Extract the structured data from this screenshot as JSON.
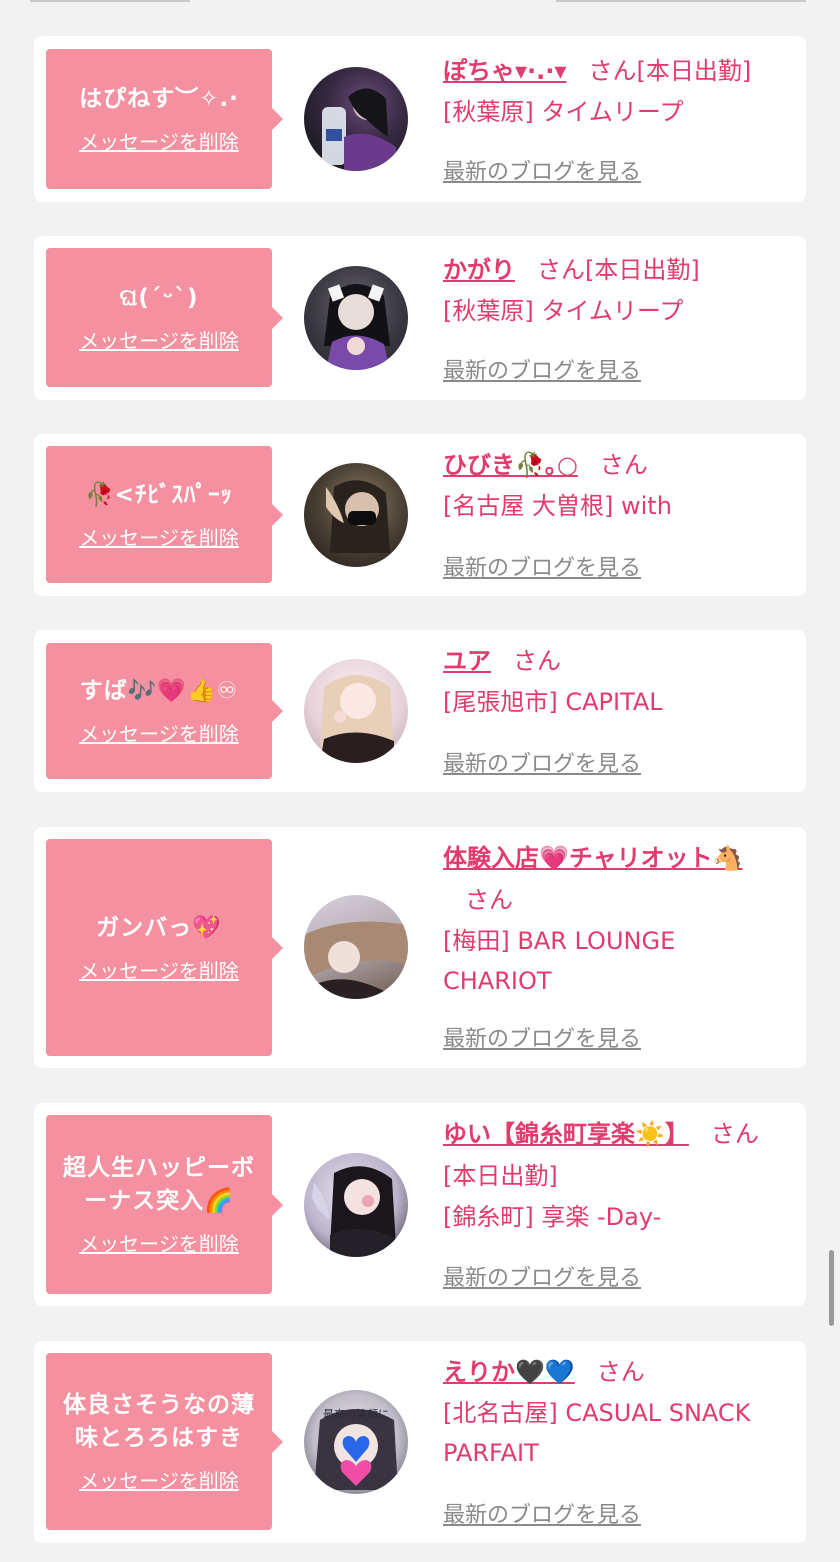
{
  "cards": [
    {
      "message": "はぴねす︶✧.·",
      "delete_label": "メッセージを削除",
      "name": "ぽちゃ▾·.·▾",
      "suffix": "さん[本日出勤]",
      "shop": "[秋葉原] タイムリープ",
      "blog_label": "最新のブログを見る",
      "avatar_colors": [
        "#1c1c26",
        "#6a4c7c"
      ]
    },
    {
      "message": "ଘ(ˊᵕˋ)",
      "delete_label": "メッセージを削除",
      "name": "かがり",
      "suffix": "さん[本日出勤]",
      "shop": "[秋葉原] タイムリープ",
      "blog_label": "最新のブログを見る",
      "avatar_colors": [
        "#4a4a52",
        "#8c6aa8"
      ]
    },
    {
      "message": "🥀<ﾁﾋﾞｽﾊﾟｰｯ",
      "delete_label": "メッセージを削除",
      "name": "ひびき🥀｡○",
      "suffix": "さん",
      "shop": "[名古屋 大曽根] with",
      "blog_label": "最新のブログを見る",
      "avatar_colors": [
        "#2a2620",
        "#8a7a62"
      ]
    },
    {
      "message": "すば🎶💗👍♾",
      "delete_label": "メッセージを削除",
      "name": "ユア",
      "suffix": "さん",
      "shop": "[尾張旭市] CAPITAL",
      "blog_label": "最新のブログを見る",
      "avatar_colors": [
        "#f0e0e4",
        "#3a2a2a"
      ]
    },
    {
      "message": "ガンバっ💖",
      "delete_label": "メッセージを削除",
      "name": "体験入店💗チャリオット🐴",
      "suffix": "さん",
      "shop": "[梅田] BAR LOUNGE CHARIOT",
      "blog_label": "最新のブログを見る",
      "avatar_colors": [
        "#c8bcc4",
        "#6e5a4e"
      ]
    },
    {
      "message": "超人生ハッピーボーナス突入🌈",
      "delete_label": "メッセージを削除",
      "name": "ゆい【錦糸町享楽☀️】",
      "suffix": "さん[本日出勤]",
      "shop": "[錦糸町] 享楽 -Day-",
      "blog_label": "最新のブログを見る",
      "avatar_colors": [
        "#d8d4e4",
        "#2a2228"
      ]
    },
    {
      "message": "体良さそうなの薄味とろろはすき",
      "delete_label": "メッセージを削除",
      "name": "えりか🖤💙",
      "suffix": "さん",
      "shop": "[北名古屋] CASUAL SNACK PARFAIT",
      "blog_label": "最新のブログを見る",
      "avatar_colors": [
        "#d8d8e0",
        "#4a4a58"
      ],
      "avatar_text": "最高の笑顔に"
    }
  ]
}
